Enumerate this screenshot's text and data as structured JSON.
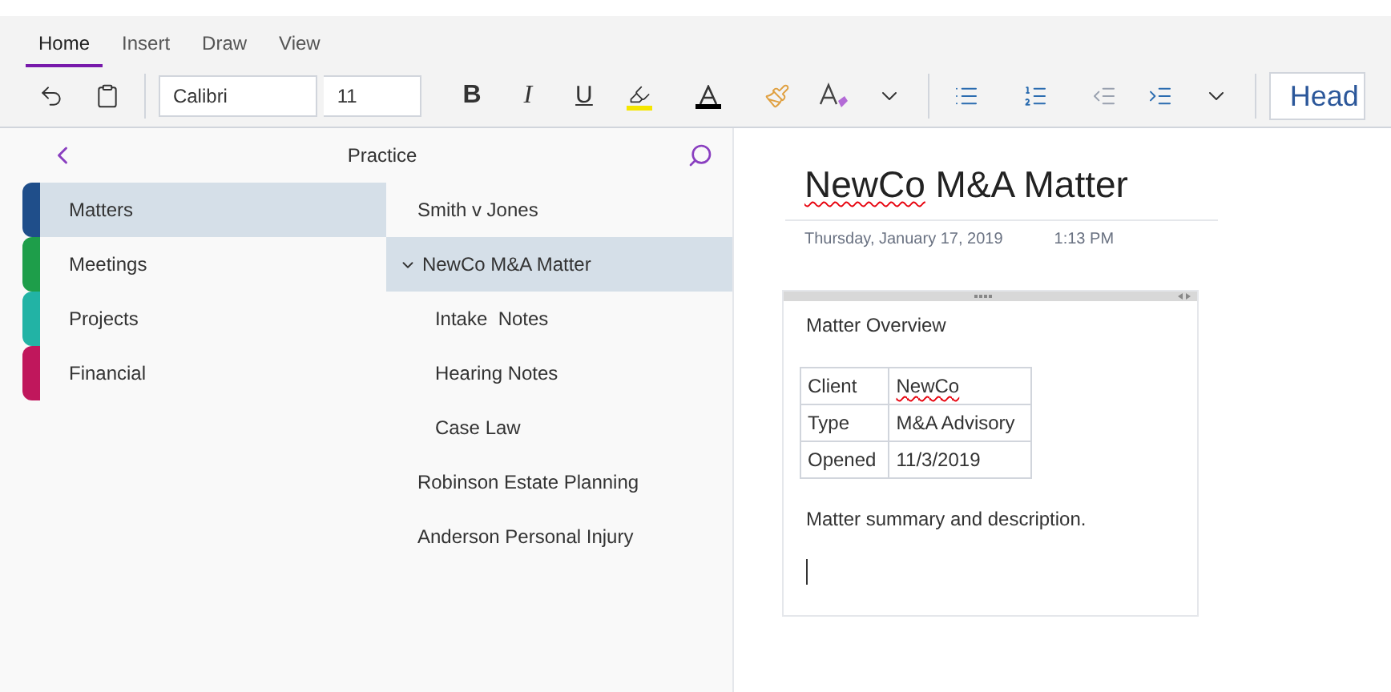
{
  "ribbon_tabs": [
    {
      "label": "Home",
      "selected": true
    },
    {
      "label": "Insert",
      "selected": false
    },
    {
      "label": "Draw",
      "selected": false
    },
    {
      "label": "View",
      "selected": false
    }
  ],
  "toolbar": {
    "font": "Calibri",
    "size": "11",
    "bold": "B",
    "italic": "I",
    "underline": "U",
    "style": "Head"
  },
  "notebook": {
    "title": "Practice"
  },
  "sections": [
    {
      "label": "Matters",
      "selected": true,
      "color": "#1f4e8a"
    },
    {
      "label": "Meetings",
      "selected": false,
      "color": "#1e9e4a"
    },
    {
      "label": "Projects",
      "selected": false,
      "color": "#22b3a5"
    },
    {
      "label": "Financial",
      "selected": false,
      "color": "#c0175c"
    }
  ],
  "pages": [
    {
      "label": "Smith v Jones",
      "selected": false
    },
    {
      "label": "NewCo M&A Matter",
      "selected": true,
      "expanded": true,
      "children": [
        {
          "label": "Intake  Notes",
          "selected": false
        },
        {
          "label": "Hearing Notes",
          "selected": false
        },
        {
          "label": "Case Law",
          "selected": false
        }
      ]
    },
    {
      "label": "Robinson Estate Planning",
      "selected": false
    },
    {
      "label": "Anderson Personal Injury",
      "selected": false
    }
  ],
  "page": {
    "title_parts": [
      {
        "text": "NewCo",
        "misspelled": true
      },
      {
        "text": " M&A Matter",
        "misspelled": false
      }
    ],
    "date": "Thursday, January 17, 2019",
    "time": "1:13 PM",
    "note": {
      "heading": "Matter Overview",
      "rows": [
        {
          "label": "Client",
          "value": "NewCo",
          "misspelled": true
        },
        {
          "label": "Type",
          "value": "M&A Advisory",
          "misspelled": false
        },
        {
          "label": "Opened",
          "value": "11/3/2019",
          "misspelled": false
        }
      ],
      "summary": "Matter summary and description."
    }
  }
}
